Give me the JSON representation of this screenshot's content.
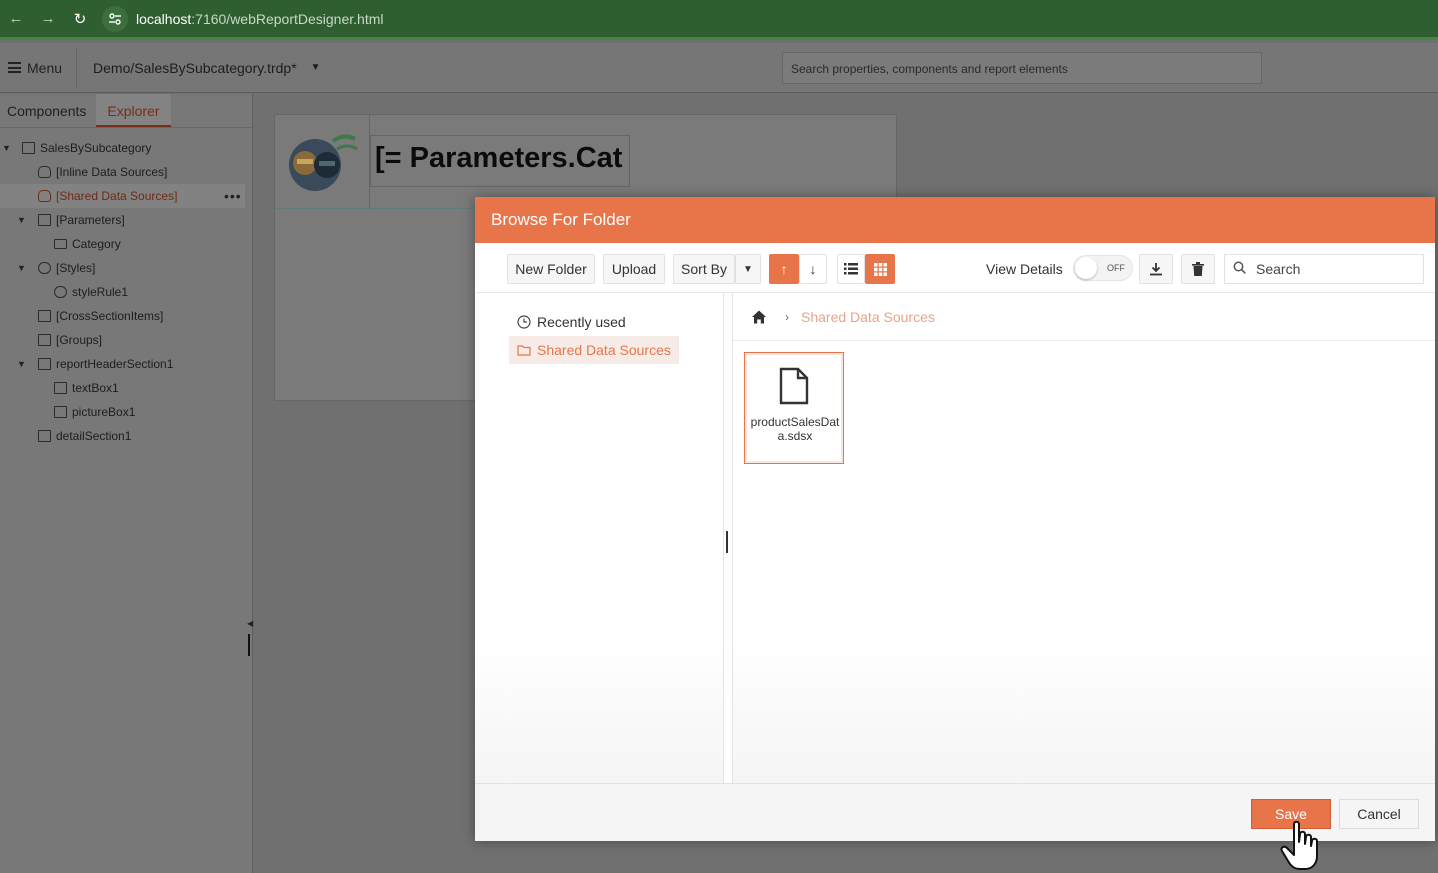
{
  "browser": {
    "url_host": "localhost",
    "url_path": ":7160/webReportDesigner.html"
  },
  "header": {
    "menu_label": "Menu",
    "document_name": "Demo/SalesBySubcategory.trdp*",
    "search_placeholder": "Search properties, components and report elements"
  },
  "left_panel": {
    "tabs": [
      {
        "label": "Components",
        "active": false
      },
      {
        "label": "Explorer",
        "active": true
      }
    ],
    "tree": [
      {
        "label": "SalesBySubcategory",
        "icon": "table-icon"
      },
      {
        "label": "[Inline Data Sources]",
        "icon": "database-icon"
      },
      {
        "label": "[Shared Data Sources]",
        "icon": "shared-database-icon",
        "selected": true
      },
      {
        "label": "[Parameters]",
        "icon": "parameters-icon"
      },
      {
        "label": "Category",
        "icon": "parameter-icon"
      },
      {
        "label": "[Styles]",
        "icon": "palette-icon"
      },
      {
        "label": "styleRule1",
        "icon": "palette-icon"
      },
      {
        "label": "[CrossSectionItems]",
        "icon": "grid-icon"
      },
      {
        "label": "[Groups]",
        "icon": "groups-icon"
      },
      {
        "label": "reportHeaderSection1",
        "icon": "section-icon"
      },
      {
        "label": "textBox1",
        "icon": "textbox-icon"
      },
      {
        "label": "pictureBox1",
        "icon": "picture-icon"
      },
      {
        "label": "detailSection1",
        "icon": "section-icon"
      }
    ]
  },
  "canvas": {
    "textbox_expression": "[= Parameters.Cat"
  },
  "dialog": {
    "title": "Browse For Folder",
    "toolbar": {
      "new_folder": "New Folder",
      "upload": "Upload",
      "sort_by": "Sort By",
      "view_details": "View Details",
      "toggle_state": "OFF",
      "search_placeholder": "Search"
    },
    "folders": [
      {
        "label": "Recently used",
        "icon": "clock-icon",
        "active": false
      },
      {
        "label": "Shared Data Sources",
        "icon": "folder-icon",
        "active": true
      }
    ],
    "breadcrumb": {
      "current": "Shared Data Sources"
    },
    "files": [
      {
        "name": "productSalesData.sdsx",
        "icon": "file-icon",
        "selected": true
      }
    ],
    "footer": {
      "save": "Save",
      "cancel": "Cancel"
    },
    "accent_color": "#e8754a"
  }
}
